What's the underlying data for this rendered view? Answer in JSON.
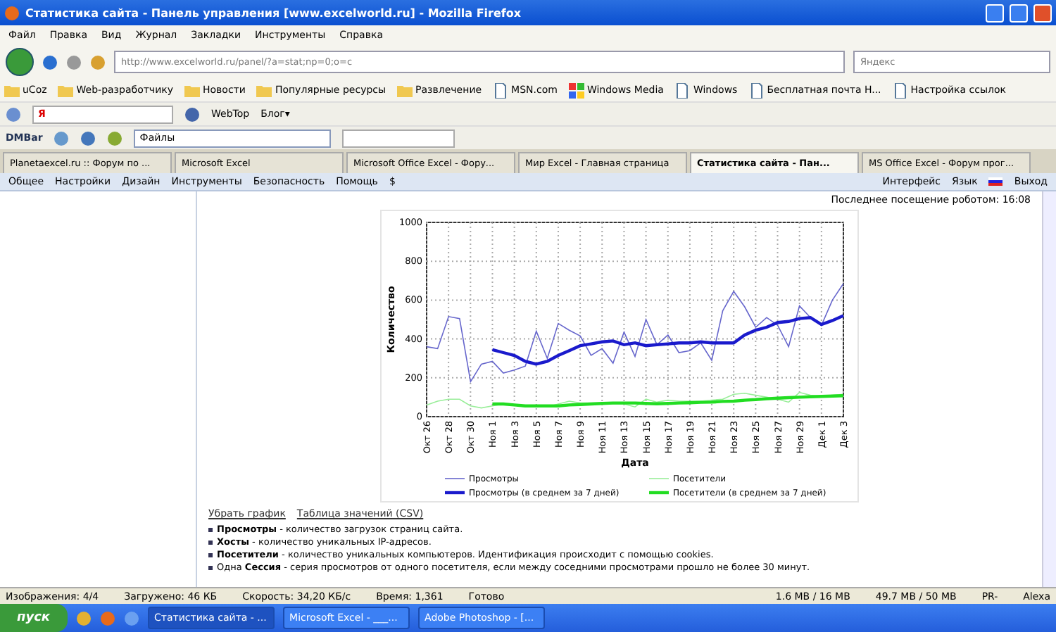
{
  "window": {
    "title": "Статистика сайта - Панель управления [www.excelworld.ru] - Mozilla Firefox"
  },
  "menu": [
    "Файл",
    "Правка",
    "Вид",
    "Журнал",
    "Закладки",
    "Инструменты",
    "Справка"
  ],
  "address": {
    "value": "http://www.excelworld.ru/panel/?a=stat;np=0;o=c"
  },
  "search": {
    "placeholder": "Яндекс"
  },
  "bookmarks": [
    {
      "label": "uCoz",
      "kind": "folder"
    },
    {
      "label": "Web-разработчику",
      "kind": "folder"
    },
    {
      "label": "Новости",
      "kind": "folder"
    },
    {
      "label": "Популярные ресурсы",
      "kind": "folder"
    },
    {
      "label": "Развлечение",
      "kind": "folder"
    },
    {
      "label": "MSN.com",
      "kind": "page"
    },
    {
      "label": "Windows Media",
      "kind": "windows"
    },
    {
      "label": "Windows",
      "kind": "page"
    },
    {
      "label": "Бесплатная почта H...",
      "kind": "page"
    },
    {
      "label": "Настройка ссылок",
      "kind": "page"
    }
  ],
  "yandex_bar": {
    "logo": "Я",
    "webtop": "WebTop",
    "blog": "Блог▾"
  },
  "dm_bar": {
    "logo": "DMBar",
    "dropdown": "Файлы"
  },
  "tabs": [
    {
      "label": "Planetaexcel.ru :: Форум по ...",
      "selected": false
    },
    {
      "label": "Microsoft Excel",
      "selected": false
    },
    {
      "label": "Microsoft Office Excel - Фору...",
      "selected": false
    },
    {
      "label": "Мир Excel - Главная страница",
      "selected": false
    },
    {
      "label": "Статистика сайта - Пан...",
      "selected": true
    },
    {
      "label": "MS Office Excel - Форум прог...",
      "selected": false
    }
  ],
  "site_menu": [
    "Общее",
    "Настройки",
    "Дизайн",
    "Инструменты",
    "Безопасность",
    "Помощь",
    "$"
  ],
  "site_menu_right": {
    "interface": "Интерфейс",
    "language": "Язык",
    "logout": "Выход"
  },
  "robot_visit": "Последнее посещение роботом: 16:08",
  "chart_data": {
    "type": "line",
    "xlabel": "Дата",
    "ylabel": "Количество",
    "categories": [
      "Окт 26",
      null,
      "Окт 28",
      null,
      "Окт 30",
      null,
      "Ноя 1",
      null,
      "Ноя 3",
      null,
      "Ноя 5",
      null,
      "Ноя 7",
      null,
      "Ноя 9",
      null,
      "Ноя 11",
      null,
      "Ноя 13",
      null,
      "Ноя 15",
      null,
      "Ноя 17",
      null,
      "Ноя 19",
      null,
      "Ноя 21",
      null,
      "Ноя 23",
      null,
      "Ноя 25",
      null,
      "Ноя 27",
      null,
      "Ноя 29",
      null,
      "Дек 1",
      null,
      "Дек 3"
    ],
    "ylim": [
      0,
      1000
    ],
    "grid": true,
    "legend": "bottom",
    "yticks": [
      0,
      200,
      400,
      600,
      800,
      1000
    ],
    "series": [
      {
        "name": "Просмотры",
        "color": "#6666cc",
        "values": [
          360,
          350,
          515,
          505,
          180,
          270,
          285,
          225,
          240,
          260,
          440,
          300,
          480,
          445,
          415,
          315,
          350,
          275,
          435,
          310,
          500,
          370,
          420,
          330,
          340,
          380,
          290,
          545,
          645,
          565,
          460,
          510,
          470,
          360,
          570,
          510,
          470,
          600,
          685
        ]
      },
      {
        "name": "Посетители",
        "color": "#99ee99",
        "values": [
          60,
          80,
          90,
          90,
          55,
          45,
          55,
          65,
          60,
          50,
          55,
          50,
          65,
          80,
          70,
          70,
          70,
          65,
          65,
          50,
          90,
          75,
          85,
          80,
          80,
          80,
          85,
          90,
          115,
          120,
          110,
          100,
          90,
          75,
          125,
          110,
          105,
          110,
          115
        ]
      },
      {
        "name": "Просмотры (в среднем за 7 дней)",
        "color": "#1a1acc",
        "values": [
          null,
          null,
          null,
          null,
          null,
          null,
          345,
          330,
          315,
          285,
          270,
          285,
          315,
          340,
          365,
          375,
          385,
          390,
          370,
          380,
          365,
          370,
          375,
          380,
          380,
          385,
          380,
          380,
          380,
          420,
          445,
          460,
          485,
          490,
          505,
          510,
          475,
          495,
          520
        ]
      },
      {
        "name": "Посетители (в среднем за 7 дней)",
        "color": "#22dd22",
        "values": [
          null,
          null,
          null,
          null,
          null,
          null,
          65,
          65,
          60,
          55,
          55,
          55,
          55,
          60,
          62,
          65,
          68,
          70,
          70,
          70,
          68,
          66,
          68,
          70,
          72,
          74,
          75,
          78,
          80,
          85,
          88,
          92,
          95,
          98,
          100,
          102,
          104,
          106,
          108
        ]
      }
    ]
  },
  "chart_links": [
    "Убрать график",
    "Таблица значений (CSV)"
  ],
  "definitions": [
    "**Просмотры** - количество загрузок страниц сайта.",
    "**Хосты** - количество уникальных IP-адресов.",
    "**Посетители** - количество уникальных компьютеров. Идентификация происходит с помощью cookies.",
    "Одна **Сессия** - серия просмотров от одного посетителя, если между соседними просмотрами прошло не более 30 минут."
  ],
  "status_bar": {
    "items": [
      "Изображения: 4/4",
      "Загружено: 46 КБ",
      "Скорость: 34,20 КБ/с",
      "Время: 1,361",
      "Готово"
    ],
    "memory": [
      "1.6 MB / 16 MB",
      "49.7 MB / 50 MB"
    ],
    "extras": [
      "PR-",
      "Alexa"
    ]
  },
  "taskbar": {
    "start": "пуск",
    "tasks": [
      {
        "label": "Статистика сайта - ...",
        "selected": true
      },
      {
        "label": "Microsoft Excel - ___...",
        "selected": false
      },
      {
        "label": "Adobe Photoshop - [...",
        "selected": false
      }
    ]
  }
}
